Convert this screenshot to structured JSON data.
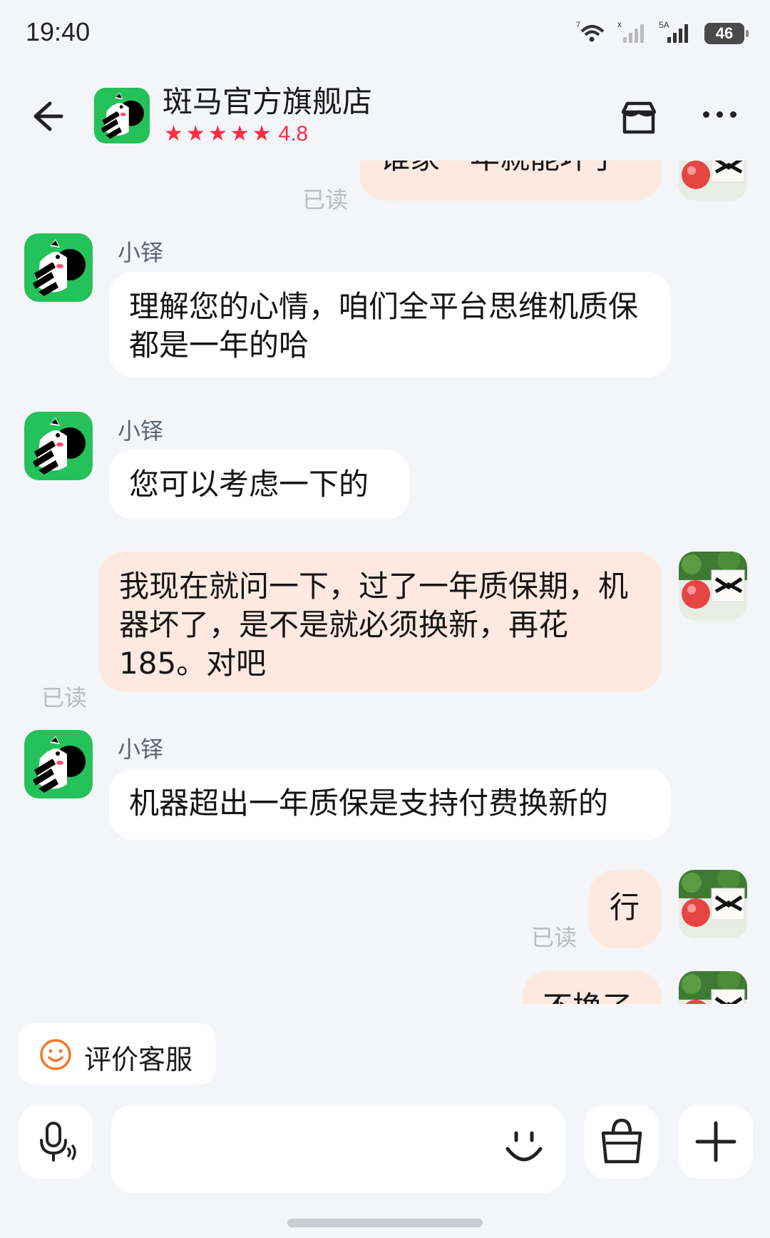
{
  "status_bar": {
    "time": "19:40",
    "network_labels": [
      "7",
      "x",
      "5A"
    ],
    "battery": "46"
  },
  "header": {
    "shop_name": "斑马官方旗舰店",
    "rating": "4.8",
    "stars": 5,
    "icons": {
      "back": "back-arrow-icon",
      "store": "store-icon",
      "more": "more-icon"
    }
  },
  "messages": [
    {
      "side": "out",
      "text": "谁家一年就能坏了",
      "read_label": "已读",
      "partial": "top"
    },
    {
      "side": "in",
      "sender": "小铎",
      "text": "理解您的心情，咱们全平台思维机质保都是一年的哈"
    },
    {
      "side": "in",
      "sender": "小铎",
      "text": "您可以考虑一下的"
    },
    {
      "side": "out",
      "text": "我现在就问一下，过了一年质保期，机器坏了，是不是就必须换新，再花185。对吧",
      "read_label": "已读"
    },
    {
      "side": "in",
      "sender": "小铎",
      "text": "机器超出一年质保是支持付费换新的"
    },
    {
      "side": "out",
      "text": "行",
      "read_label": "已读"
    },
    {
      "side": "out",
      "text": "不换了",
      "partial": "bottom"
    }
  ],
  "quick_action": {
    "label": "评价客服",
    "icon": "smile-icon"
  },
  "input_bar": {
    "placeholder": "",
    "icons": [
      "voice-mic-icon",
      "emoji-icon",
      "shopping-bag-icon",
      "plus-icon"
    ]
  },
  "colors": {
    "accent_red": "#ff2a44",
    "brand_green": "#22c55e",
    "out_bubble": "#fde9df",
    "in_bubble": "#ffffff",
    "background": "#f3f5f8"
  }
}
